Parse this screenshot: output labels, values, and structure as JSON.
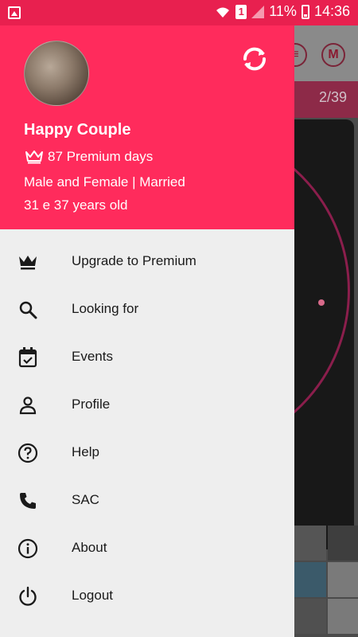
{
  "status_bar": {
    "battery_percent": "11%",
    "time": "14:36",
    "sim_label": "1"
  },
  "background_app": {
    "top_icon_letter": "M",
    "counter": "2/39"
  },
  "drawer": {
    "user": {
      "name": "Happy Couple",
      "premium_days": "87 Premium days",
      "info": "Male and Female | Married",
      "age": "31 e 37 years old"
    },
    "menu": [
      {
        "label": "Upgrade to Premium",
        "icon": "crown-icon"
      },
      {
        "label": "Looking for",
        "icon": "search-icon"
      },
      {
        "label": "Events",
        "icon": "calendar-icon"
      },
      {
        "label": "Profile",
        "icon": "person-icon"
      },
      {
        "label": "Help",
        "icon": "help-icon"
      },
      {
        "label": "SAC",
        "icon": "phone-icon"
      },
      {
        "label": "About",
        "icon": "info-icon"
      },
      {
        "label": "Logout",
        "icon": "power-icon"
      }
    ]
  },
  "colors": {
    "header": "#ff2b5c",
    "status_bar": "#e8204f",
    "drawer_bg": "#eeeeee"
  }
}
